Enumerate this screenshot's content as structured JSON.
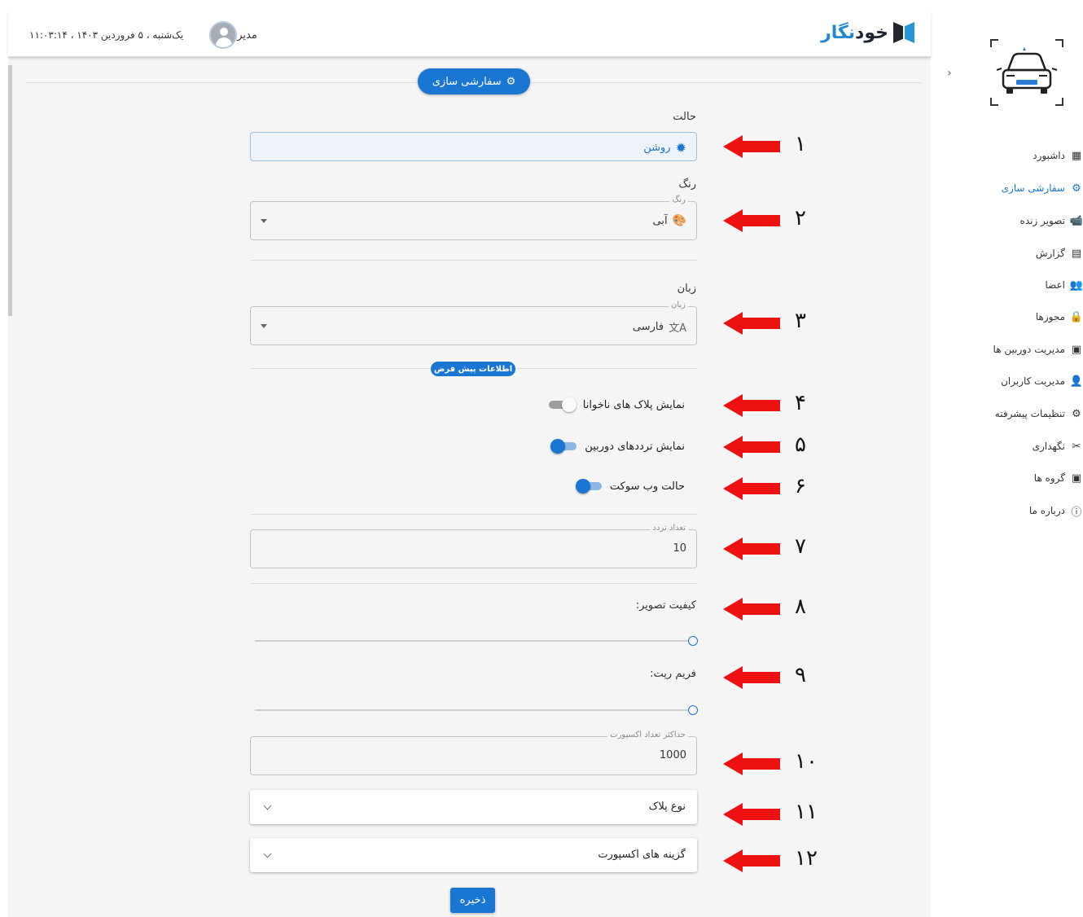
{
  "header": {
    "logo_text_dark": "خود",
    "logo_text_blue": "نگار",
    "username": "مدیر",
    "datetime": "یک‌شنبه ، ۵ فروردین ۱۴۰۳ ، ۱۱:۰۳:۱۴"
  },
  "page": {
    "section_title": "سفارشی سازی",
    "default_info_label": "اطلاعات پیش فرض",
    "save_label": "ذخیره"
  },
  "form": {
    "mode": {
      "label": "حالت",
      "value": "روشن"
    },
    "color": {
      "label": "رنگ",
      "legend": "رنگ",
      "value": "آبی"
    },
    "language": {
      "label": "زبان",
      "legend": "زبان",
      "value": "فارسی"
    },
    "toggles": [
      {
        "label": "نمایش پلاک های ناخوانا",
        "on": false
      },
      {
        "label": "نمایش ترددهای دوربین",
        "on": true
      },
      {
        "label": "حالت وب سوکت",
        "on": true
      }
    ],
    "traffic_count": {
      "legend": "تعداد تردد",
      "value": "10"
    },
    "image_quality": {
      "label": "کیفیت تصویر:",
      "level": 0
    },
    "frame_rate": {
      "label": "فریم ریت:",
      "level": 0
    },
    "max_export": {
      "legend": "حداکثر تعداد اکسپورت",
      "value": "1000"
    },
    "plate_type": {
      "label": "نوع پلاک"
    },
    "export_options": {
      "label": "گزینه های اکسپورت"
    }
  },
  "annotations": [
    "۱",
    "۲",
    "۳",
    "۴",
    "۵",
    "۶",
    "۷",
    "۸",
    "۹",
    "۱۰",
    "۱۱",
    "۱۲"
  ],
  "sidebar": {
    "items": [
      {
        "label": "داشبورد",
        "icon": "dashboard-icon",
        "glyph": "▦"
      },
      {
        "label": "سفارشی سازی",
        "icon": "gear-icon",
        "glyph": "⚙"
      },
      {
        "label": "تصویر زنده",
        "icon": "cctv-icon",
        "glyph": "📹"
      },
      {
        "label": "گزارش",
        "icon": "report-icon",
        "glyph": "▤"
      },
      {
        "label": "اعضا",
        "icon": "members-icon",
        "glyph": "👥"
      },
      {
        "label": "مجوزها",
        "icon": "lock-icon",
        "glyph": "🔒"
      },
      {
        "label": "مدیریت دوربین ها",
        "icon": "camera-manage-icon",
        "glyph": "▣"
      },
      {
        "label": "مدیریت کاربران",
        "icon": "user-manage-icon",
        "glyph": "👤"
      },
      {
        "label": "تنظیمات پیشرفته",
        "icon": "advanced-settings-icon",
        "glyph": "⚙"
      },
      {
        "label": "نگهداری",
        "icon": "tools-icon",
        "glyph": "✂"
      },
      {
        "label": "گروه ها",
        "icon": "groups-icon",
        "glyph": "▣"
      },
      {
        "label": "درباره ما",
        "icon": "info-icon",
        "glyph": "ⓘ"
      }
    ]
  },
  "colors": {
    "primary": "#1976d2",
    "arrow": "#ee1111",
    "background": "#f5f5f5"
  }
}
